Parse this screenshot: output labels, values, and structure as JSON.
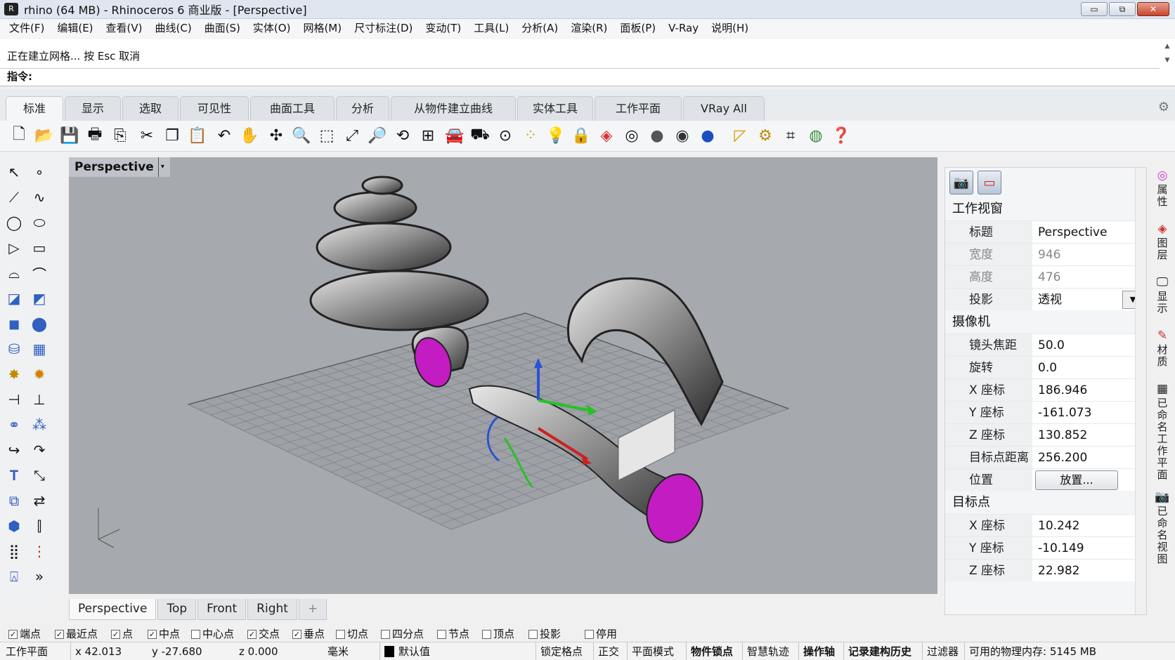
{
  "window": {
    "title": "rhino (64 MB) - Rhinoceros 6 商业版 - [Perspective]",
    "minimize": "▭",
    "restore": "⧉",
    "close": "✕"
  },
  "menu": [
    "文件(F)",
    "编辑(E)",
    "查看(V)",
    "曲线(C)",
    "曲面(S)",
    "实体(O)",
    "网格(M)",
    "尺寸标注(D)",
    "变动(T)",
    "工具(L)",
    "分析(A)",
    "渲染(R)",
    "面板(P)",
    "V-Ray",
    "说明(H)"
  ],
  "command": {
    "history": "正在建立网格... 按 Esc 取消",
    "prompt": "指令:"
  },
  "tabs": [
    "标准",
    "显示",
    "选取",
    "可见性",
    "曲面工具",
    "分析",
    "从物件建立曲线",
    "实体工具",
    "工作平面",
    "VRay All"
  ],
  "viewport": {
    "label": "Perspective",
    "tabs": [
      "Perspective",
      "Top",
      "Front",
      "Right"
    ],
    "add_tab": "+"
  },
  "properties": {
    "section_viewport": "工作视窗",
    "title_label": "标题",
    "title_value": "Perspective",
    "width_label": "宽度",
    "width_value": "946",
    "height_label": "高度",
    "height_value": "476",
    "projection_label": "投影",
    "projection_value": "透视",
    "section_camera": "摄像机",
    "lens_label": "镜头焦距",
    "lens_value": "50.0",
    "rotation_label": "旋转",
    "rotation_value": "0.0",
    "cx_label": "X 座标",
    "cx_value": "186.946",
    "cy_label": "Y 座标",
    "cy_value": "-161.073",
    "cz_label": "Z 座标",
    "cz_value": "130.852",
    "target_dist_label": "目标点距离",
    "target_dist_value": "256.200",
    "position_label": "位置",
    "place_button": "放置...",
    "section_target": "目标点",
    "tx_label": "X 座标",
    "tx_value": "10.242",
    "ty_label": "Y 座标",
    "ty_value": "-10.149",
    "tz_label": "Z 座标",
    "tz_value": "22.982"
  },
  "side_tabs": [
    "属性",
    "图层",
    "显示",
    "材质",
    "已命名工作平面",
    "已命名视图"
  ],
  "osnaps": [
    {
      "label": "端点",
      "checked": true
    },
    {
      "label": "最近点",
      "checked": true
    },
    {
      "label": "点",
      "checked": true
    },
    {
      "label": "中点",
      "checked": true
    },
    {
      "label": "中心点",
      "checked": false
    },
    {
      "label": "交点",
      "checked": true
    },
    {
      "label": "垂点",
      "checked": true
    },
    {
      "label": "切点",
      "checked": false
    },
    {
      "label": "四分点",
      "checked": false
    },
    {
      "label": "节点",
      "checked": false
    },
    {
      "label": "顶点",
      "checked": false
    },
    {
      "label": "投影",
      "checked": false
    }
  ],
  "osnap_disable": "停用",
  "status": {
    "cplane": "工作平面",
    "x": "x 42.013",
    "y": "y -27.680",
    "z": "z 0.000",
    "unit": "毫米",
    "layer": "默认值",
    "grid_snap": "锁定格点",
    "ortho": "正交",
    "planar": "平面模式",
    "osnap": "物件锁点",
    "smarttrack": "智慧轨迹",
    "gumball": "操作轴",
    "history": "记录建构历史",
    "filter": "过滤器",
    "memory": "可用的物理内存: 5145 MB"
  }
}
